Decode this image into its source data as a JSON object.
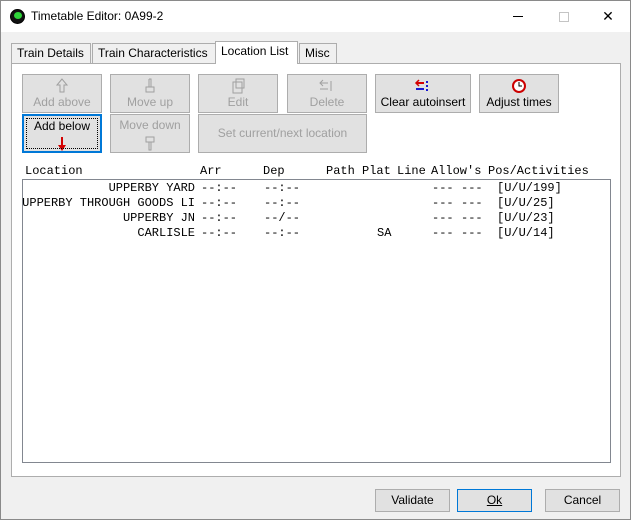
{
  "window": {
    "title": "Timetable Editor: 0A99-2",
    "minimize": "—",
    "maximize": "☐",
    "close": "✕"
  },
  "tabs": [
    {
      "label": "Train Details"
    },
    {
      "label": "Train Characteristics"
    },
    {
      "label": "Location List"
    },
    {
      "label": "Misc"
    }
  ],
  "toolbar": {
    "add_above": "Add above",
    "move_up": "Move up",
    "edit": "Edit",
    "delete": "Delete",
    "clear_autoinsert": "Clear autoinsert",
    "adjust_times": "Adjust times",
    "add_below": "Add below",
    "move_down": "Move down",
    "set_current_next": "Set current/next location"
  },
  "icons": {
    "add_above": "arrow-up-icon",
    "move_up": "hand-up-icon",
    "edit": "edit-icon",
    "delete": "delete-icon",
    "clear_autoinsert": "clear-autoinsert-icon",
    "adjust_times": "clock-icon",
    "add_below": "arrow-down-icon",
    "move_down": "hand-down-icon"
  },
  "colors": {
    "accent": "#0078d7",
    "down_arrow": "#d40000",
    "clock": "#cc0000"
  },
  "list": {
    "headers": [
      "Location",
      "Arr",
      "Dep",
      "Path",
      "Plat",
      "Line",
      "Allow's",
      "Pos/Activities"
    ],
    "rows": [
      {
        "location": "UPPERBY YARD",
        "arr": "--:--",
        "dep": "--:--",
        "path": "",
        "plat": "",
        "line": "",
        "allow1": "---",
        "allow2": "---",
        "pos": "[U/U/199]"
      },
      {
        "location": "UPPERBY THROUGH GOODS LI",
        "arr": "--:--",
        "dep": "--:--",
        "path": "",
        "plat": "",
        "line": "",
        "allow1": "---",
        "allow2": "---",
        "pos": "[U/U/25]"
      },
      {
        "location": "UPPERBY JN",
        "arr": "--:--",
        "dep": "--/--",
        "path": "",
        "plat": "",
        "line": "",
        "allow1": "---",
        "allow2": "---",
        "pos": "[U/U/23]"
      },
      {
        "location": "CARLISLE",
        "arr": "--:--",
        "dep": "--:--",
        "path": "",
        "plat": "SA",
        "line": "",
        "allow1": "---",
        "allow2": "---",
        "pos": "[U/U/14]"
      }
    ]
  },
  "footer": {
    "validate": "Validate",
    "ok": "Ok",
    "cancel": "Cancel"
  }
}
